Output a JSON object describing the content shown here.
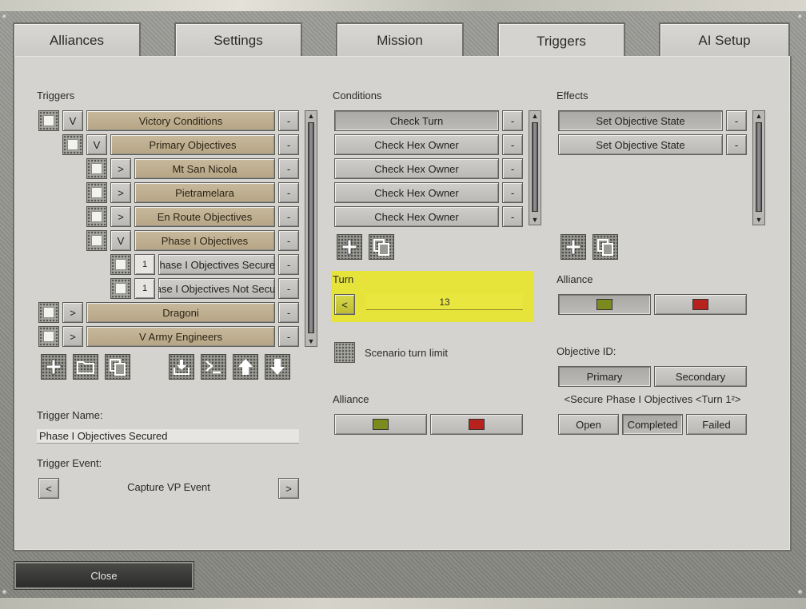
{
  "tabs": [
    {
      "label": "Alliances"
    },
    {
      "label": "Settings"
    },
    {
      "label": "Mission"
    },
    {
      "label": "Triggers"
    },
    {
      "label": "AI Setup"
    }
  ],
  "triggers": {
    "header": "Triggers",
    "items": [
      {
        "toggle": "V",
        "label": "Victory Conditions",
        "remove": "-"
      },
      {
        "toggle": "V",
        "label": "Primary Objectives",
        "remove": "-"
      },
      {
        "toggle": ">",
        "label": "Mt San Nicola",
        "remove": "-"
      },
      {
        "toggle": ">",
        "label": "Pietramelara",
        "remove": "-"
      },
      {
        "toggle": ">",
        "label": "En Route Objectives",
        "remove": "-"
      },
      {
        "toggle": "V",
        "label": "Phase I Objectives",
        "remove": "-"
      },
      {
        "toggle": "1",
        "label": "Phase I Objectives Secured",
        "remove": "-"
      },
      {
        "toggle": "1",
        "label": "Phase I Objectives Not Secured",
        "remove": "-"
      },
      {
        "toggle": ">",
        "label": "Dragoni",
        "remove": "-"
      },
      {
        "toggle": ">",
        "label": "V Army Engineers",
        "remove": "-"
      }
    ],
    "name_label": "Trigger Name:",
    "name_value": "Phase I Objectives Secured",
    "event_label": "Trigger Event:",
    "event_value": "Capture VP Event",
    "prev": "<",
    "next": ">"
  },
  "conditions": {
    "header": "Conditions",
    "items": [
      {
        "label": "Check Turn",
        "remove": "-"
      },
      {
        "label": "Check Hex Owner",
        "remove": "-"
      },
      {
        "label": "Check Hex Owner",
        "remove": "-"
      },
      {
        "label": "Check Hex Owner",
        "remove": "-"
      },
      {
        "label": "Check Hex Owner",
        "remove": "-"
      }
    ],
    "turn_label": "Turn",
    "turn_prev": "<",
    "turn_value": "13",
    "scenario_limit_label": "Scenario turn limit",
    "alliance_label": "Alliance"
  },
  "effects": {
    "header": "Effects",
    "items": [
      {
        "label": "Set Objective State",
        "remove": "-"
      },
      {
        "label": "Set Objective State",
        "remove": "-"
      }
    ],
    "alliance_label": "Alliance",
    "objective_id_label": "Objective ID:",
    "primary": "Primary",
    "secondary": "Secondary",
    "objective_selector": "<Secure Phase I Objectives <Turn 1²>",
    "states": [
      "Open",
      "Completed",
      "Failed"
    ]
  },
  "colors": {
    "allied_green": "#7d8a1d",
    "axis_red": "#b8221c",
    "turn_highlight": "#e6e43a"
  },
  "close_label": "Close"
}
